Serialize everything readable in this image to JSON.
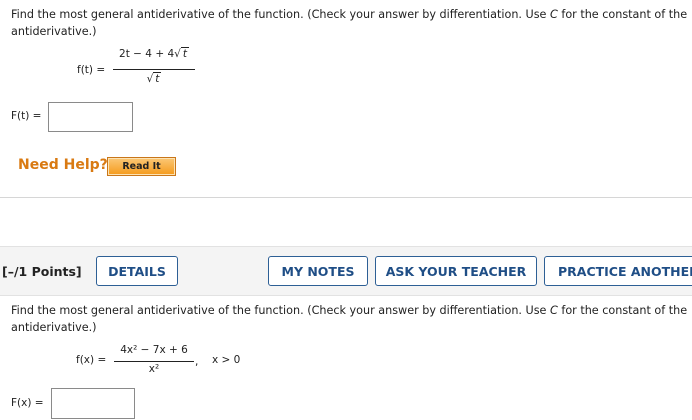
{
  "problem1": {
    "instruction_line1": "Find the most general antiderivative of the function. (Check your answer by differentiation. Use",
    "instruction_c": "C",
    "instruction_after_c": "for the constant of the",
    "instruction_line2": "antiderivative.)",
    "function_label": "f(t) =",
    "numerator": "2t − 4 + 4",
    "numerator_radicand": "t",
    "denominator_radicand": "t",
    "answer_label": "F(t) =",
    "answer_value": ""
  },
  "help": {
    "need_help_label": "Need Help?",
    "read_it_label": "Read It"
  },
  "problem2_header": {
    "points_label": "[–/1 Points]",
    "details_label": "DETAILS",
    "my_notes_label": "MY NOTES",
    "ask_teacher_label": "ASK YOUR TEACHER",
    "practice_label": "PRACTICE ANOTHER"
  },
  "problem2": {
    "instruction_line1": "Find the most general antiderivative of the function. (Check your answer by differentiation. Use",
    "instruction_c": "C",
    "instruction_after_c": "for the constant of the",
    "instruction_line2": "antiderivative.)",
    "function_label": "f(x) =",
    "numerator": "4x² − 7x + 6",
    "denominator": "x²",
    "trailing_comma": ",",
    "condition": "x > 0",
    "answer_label": "F(x) =",
    "answer_value": ""
  }
}
